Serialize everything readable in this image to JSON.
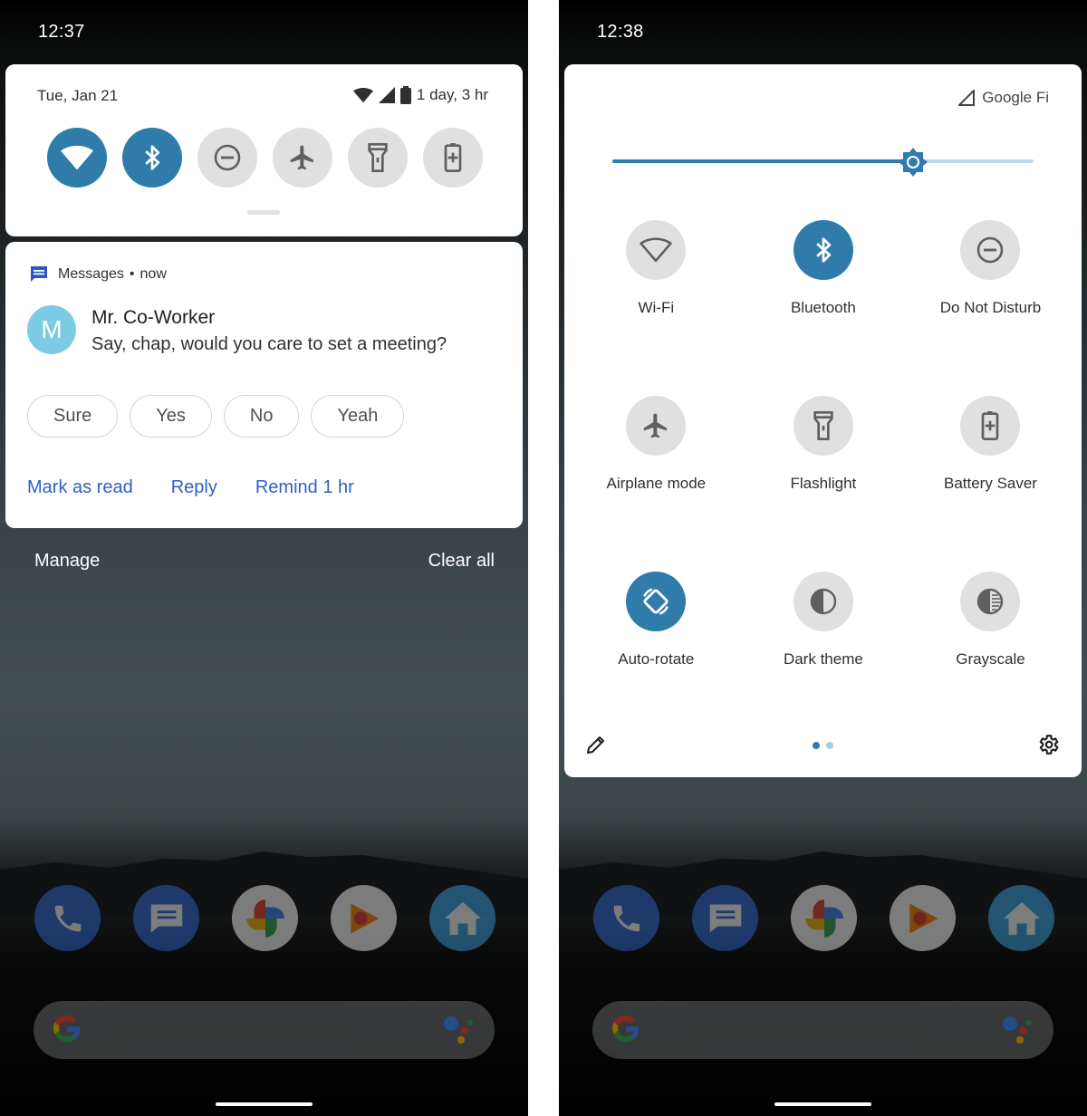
{
  "left": {
    "status_time": "12:37",
    "quick_settings": {
      "date": "Tue, Jan 21",
      "battery_text": "1 day, 3 hr",
      "tiles": [
        {
          "icon": "wifi-icon",
          "state": "on"
        },
        {
          "icon": "bluetooth-icon",
          "state": "on"
        },
        {
          "icon": "do-not-disturb-icon",
          "state": "off"
        },
        {
          "icon": "airplane-icon",
          "state": "off"
        },
        {
          "icon": "flashlight-icon",
          "state": "off"
        },
        {
          "icon": "battery-saver-icon",
          "state": "off"
        }
      ]
    },
    "notification": {
      "app": "Messages",
      "separator": "•",
      "time": "now",
      "avatar_letter": "M",
      "sender": "Mr. Co-Worker",
      "message": "Say, chap, would you care to set a meeting?",
      "smart_replies": [
        "Sure",
        "Yes",
        "No",
        "Yeah"
      ],
      "actions": [
        "Mark as read",
        "Reply",
        "Remind 1 hr"
      ]
    },
    "manage_label": "Manage",
    "clear_all_label": "Clear all"
  },
  "right": {
    "status_time": "12:38",
    "carrier": "Google Fi",
    "brightness_fraction": 0.715,
    "tiles": [
      {
        "label": "Wi-Fi",
        "icon": "wifi-icon",
        "state": "off"
      },
      {
        "label": "Bluetooth",
        "icon": "bluetooth-icon",
        "state": "on"
      },
      {
        "label": "Do Not Disturb",
        "icon": "do-not-disturb-icon",
        "state": "off"
      },
      {
        "label": "Airplane mode",
        "icon": "airplane-icon",
        "state": "off"
      },
      {
        "label": "Flashlight",
        "icon": "flashlight-icon",
        "state": "off"
      },
      {
        "label": "Battery Saver",
        "icon": "battery-saver-icon",
        "state": "off"
      },
      {
        "label": "Auto-rotate",
        "icon": "auto-rotate-icon",
        "state": "on"
      },
      {
        "label": "Dark theme",
        "icon": "dark-theme-icon",
        "state": "off"
      },
      {
        "label": "Grayscale",
        "icon": "grayscale-icon",
        "state": "off"
      }
    ],
    "page_indicator": {
      "current": 1,
      "total": 2
    }
  },
  "colors": {
    "accent": "#2f7cab",
    "tile_off": "#e0e0e0",
    "action_link": "#2f60c8",
    "avatar": "#7ccbe4"
  }
}
